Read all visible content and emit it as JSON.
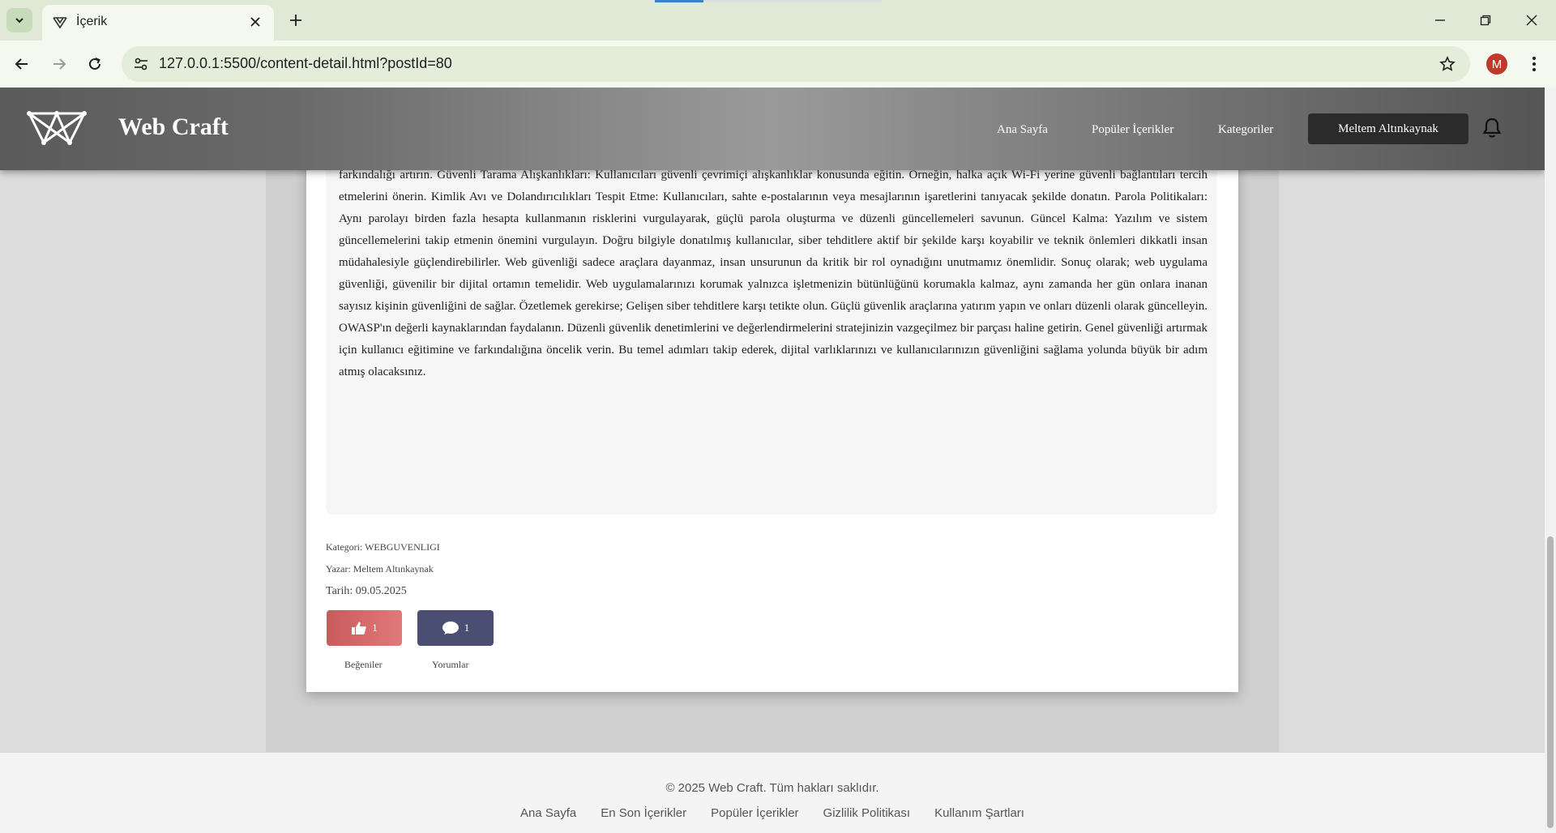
{
  "browser": {
    "tab_title": "İçerik",
    "url": "127.0.0.1:5500/content-detail.html?postId=80",
    "profile_initial": "M"
  },
  "header": {
    "brand": "Web Craft",
    "nav": [
      "Ana Sayfa",
      "Popüler İçerikler",
      "Kategoriler"
    ],
    "user_name": "Meltem Altınkaynak"
  },
  "post": {
    "body": "Düzenli denetimler ve dikkatli izleme, sadece işinizi korumakla kalmaz, aynı zamanda kullanıcılarınıza daha güvenli bir deneyim sunar. Her zaman değişen dijital dünyada, bu önlemler, uygulamanızı potansiyel tehditlere karşı dayanma gücü sağlar. Kullanıcı Eğitimi ve Farkındalığı - İnsan Kalkanı Kullanıcıları bilgi ile güçlendirmek, yaklaşan tehlikelere karşı güçlü bir duvar oluşturmanın anahtarıdır. Peki, web güvenliği ile ilgili kullanıcıları eğitme yolunda nelere dikkat etmelisiniz? İşte size bazı öneriler: Güvenlik Farkındalığını Teşvik Edin: Kimlik avı dolandırıcılığı ve sosyal mühendislik saldırılarının yaygınlığını vurgulayarak, web uygulamalarıyla ilişkili güvenlik riskleri hakkında farkındalığı artırın. Güvenli Tarama Alışkanlıkları: Kullanıcıları güvenli çevrimiçi alışkanlıklar konusunda eğitin. Örneğin, halka açık Wi-Fi yerine güvenli bağlantıları tercih etmelerini önerin. Kimlik Avı ve Dolandırıcılıkları Tespit Etme: Kullanıcıları, sahte e-postalarının veya mesajlarının işaretlerini tanıyacak şekilde donatın. Parola Politikaları: Aynı parolayı birden fazla hesapta kullanmanın risklerini vurgulayarak, güçlü parola oluşturma ve düzenli güncellemeleri savunun. Güncel Kalma: Yazılım ve sistem güncellemelerini takip etmenin önemini vurgulayın. Doğru bilgiyle donatılmış kullanıcılar, siber tehditlere aktif bir şekilde karşı koyabilir ve teknik önlemleri dikkatli insan müdahalesiyle güçlendirebilirler. Web güvenliği sadece araçlara dayanmaz, insan unsurunun da kritik bir rol oynadığını unutmamız önemlidir. Sonuç olarak; web uygulama güvenliği, güvenilir bir dijital ortamın temelidir. Web uygulamalarınızı korumak yalnızca işletmenizin bütünlüğünü korumakla kalmaz, aynı zamanda her gün onlara inanan sayısız kişinin güvenliğini de sağlar. Özetlemek gerekirse; Gelişen siber tehditlere karşı tetikte olun. Güçlü güvenlik araçlarına yatırım yapın ve onları düzenli olarak güncelleyin. OWASP'ın değerli kaynaklarından faydalanın. Düzenli güvenlik denetimlerini ve değerlendirmelerini stratejinizin vazgeçilmez bir parçası haline getirin. Genel güvenliği artırmak için kullanıcı eğitimine ve farkındalığına öncelik verin. Bu temel adımları takip ederek, dijital varlıklarınızı ve kullanıcılarınızın güvenliğini sağlama yolunda büyük bir adım atmış olacaksınız.",
    "category": "Kategori: WEBGUVENLIGI",
    "author": "Yazar: Meltem Altınkaynak",
    "date": "Tarih: 09.05.2025",
    "likes_count": "1",
    "comments_count": "1",
    "likes_label": "Beğeniler",
    "comments_label": "Yorumlar"
  },
  "footer": {
    "copyright": "© 2025 Web Craft. Tüm hakları saklıdır.",
    "links": [
      "Ana Sayfa",
      "En Son İçerikler",
      "Popüler İçerikler",
      "Gizlilik Politikası",
      "Kullanım Şartları"
    ]
  }
}
